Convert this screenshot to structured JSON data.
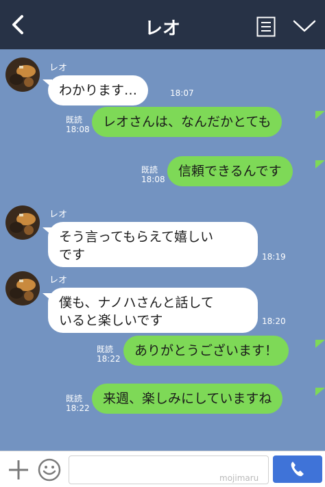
{
  "header": {
    "title": "レオ",
    "back_icon": "chevron-left-icon",
    "menu_icon": "list-icon",
    "expand_icon": "chevron-down-icon"
  },
  "messages": [
    {
      "side": "in",
      "sender": "レオ",
      "text": "わかります…",
      "time": "18:07"
    },
    {
      "side": "out",
      "read": "既読",
      "time": "18:08",
      "text": "レオさんは、なんだかとても"
    },
    {
      "side": "out",
      "read": "既読",
      "time": "18:08",
      "text": "信頼できるんです"
    },
    {
      "side": "in",
      "sender": "レオ",
      "line1": "そう言ってもらえて嬉しい",
      "line2": "です",
      "time": "18:19"
    },
    {
      "side": "in",
      "sender": "レオ",
      "line1": "僕も、ナノハさんと話して",
      "line2": "いると楽しいです",
      "time": "18:20"
    },
    {
      "side": "out",
      "read": "既読",
      "time": "18:22",
      "text": "ありがとうございます！"
    },
    {
      "side": "out",
      "read": "既読",
      "time": "18:22",
      "text": "来週、楽しみにしていますね"
    }
  ],
  "footer": {
    "watermark": "mojimaru",
    "plus_icon": "plus-icon",
    "emoji_icon": "smiley-icon",
    "call_icon": "phone-icon"
  },
  "colors": {
    "header_bg": "#273246",
    "chat_bg": "#7393c1",
    "incoming_bubble": "#ffffff",
    "outgoing_bubble": "#7ed957",
    "call_button": "#3f73d8"
  }
}
